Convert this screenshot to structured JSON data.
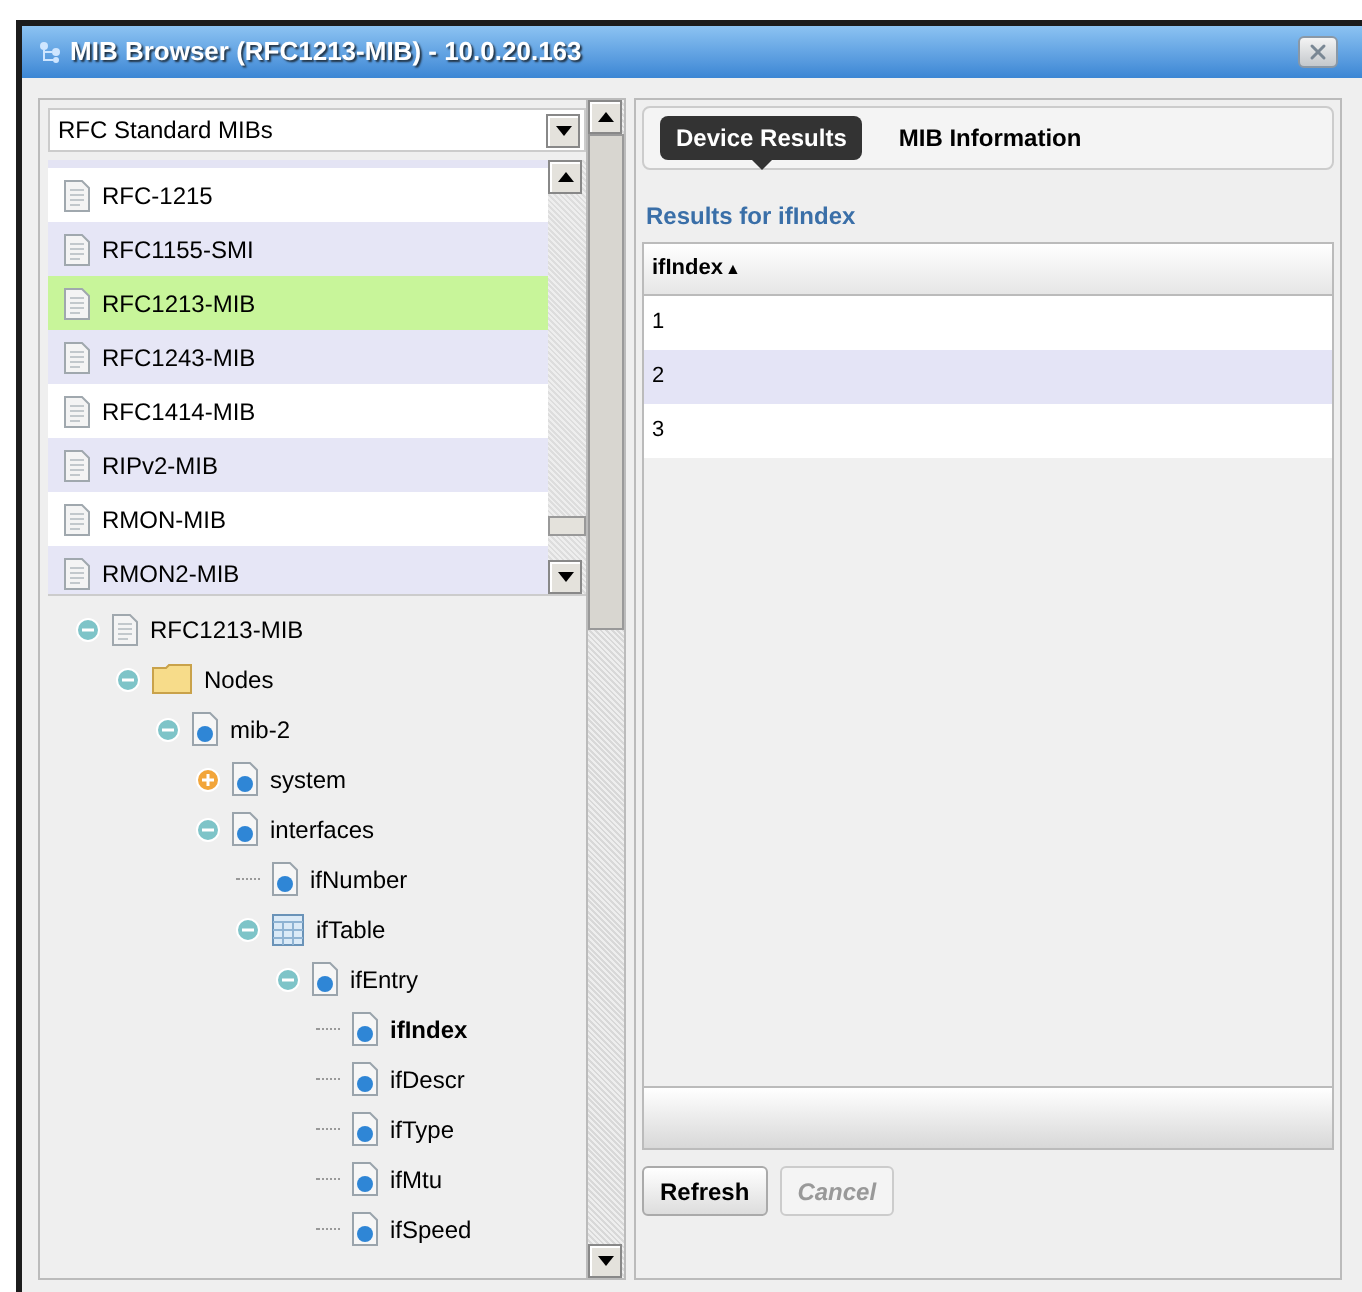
{
  "window": {
    "title": "MIB Browser (RFC1213-MIB) - 10.0.20.163"
  },
  "mib_select": {
    "value": "RFC Standard MIBs"
  },
  "mib_list": [
    {
      "label": "RFC-1215",
      "selected": false
    },
    {
      "label": "RFC1155-SMI",
      "selected": false
    },
    {
      "label": "RFC1213-MIB",
      "selected": true
    },
    {
      "label": "RFC1243-MIB",
      "selected": false
    },
    {
      "label": "RFC1414-MIB",
      "selected": false
    },
    {
      "label": "RIPv2-MIB",
      "selected": false
    },
    {
      "label": "RMON-MIB",
      "selected": false
    },
    {
      "label": "RMON2-MIB",
      "selected": false
    }
  ],
  "tree": [
    {
      "label": "RFC1213-MIB",
      "kind": "file",
      "expanded": true,
      "selected": false,
      "children": [
        {
          "label": "Nodes",
          "kind": "folder",
          "expanded": true,
          "selected": false,
          "children": [
            {
              "label": "mib-2",
              "kind": "node",
              "expanded": true,
              "selected": false,
              "children": [
                {
                  "label": "system",
                  "kind": "node",
                  "expanded": false,
                  "selected": false
                },
                {
                  "label": "interfaces",
                  "kind": "node",
                  "expanded": true,
                  "selected": false,
                  "children": [
                    {
                      "label": "ifNumber",
                      "kind": "node",
                      "selected": false
                    },
                    {
                      "label": "ifTable",
                      "kind": "table",
                      "expanded": true,
                      "selected": false,
                      "children": [
                        {
                          "label": "ifEntry",
                          "kind": "node",
                          "expanded": true,
                          "selected": false,
                          "children": [
                            {
                              "label": "ifIndex",
                              "kind": "node",
                              "selected": true
                            },
                            {
                              "label": "ifDescr",
                              "kind": "node",
                              "selected": false
                            },
                            {
                              "label": "ifType",
                              "kind": "node",
                              "selected": false
                            },
                            {
                              "label": "ifMtu",
                              "kind": "node",
                              "selected": false
                            },
                            {
                              "label": "ifSpeed",
                              "kind": "node",
                              "selected": false
                            }
                          ]
                        }
                      ]
                    }
                  ]
                }
              ]
            }
          ]
        }
      ]
    }
  ],
  "tabs": [
    {
      "label": "Device Results",
      "selected": true
    },
    {
      "label": "MIB Information",
      "selected": false
    }
  ],
  "results": {
    "heading": "Results for ifIndex",
    "columns": [
      {
        "label": "ifIndex",
        "sort": "▲"
      }
    ],
    "rows": [
      [
        "1"
      ],
      [
        "2"
      ],
      [
        "3"
      ]
    ]
  },
  "buttons": [
    {
      "label": "Refresh",
      "disabled": false
    },
    {
      "label": "Cancel",
      "disabled": true
    }
  ]
}
